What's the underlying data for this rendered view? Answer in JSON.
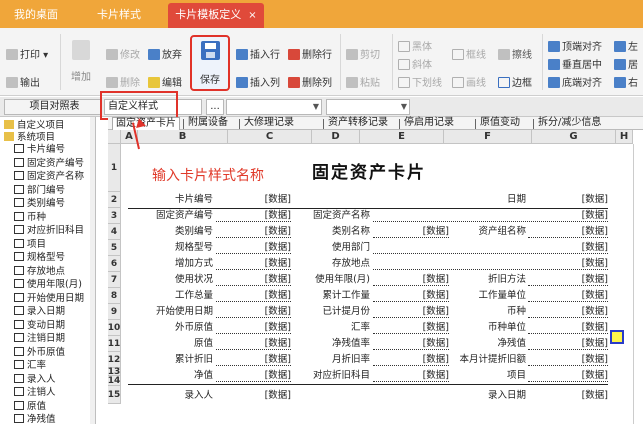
{
  "tabs": [
    {
      "label": "我的桌面"
    },
    {
      "label": "卡片样式"
    },
    {
      "label": "卡片模板定义",
      "close": "×"
    }
  ],
  "toolbar": {
    "print": "打印",
    "export": "输出",
    "add": "增加",
    "modify": "修改",
    "delete": "删除",
    "discard": "放弃",
    "edit": "编辑",
    "save": "保存",
    "insert_row": "插入行",
    "insert_col": "插入列",
    "delete_row": "删除行",
    "delete_col": "删除列",
    "cut": "剪切",
    "paste": "粘贴",
    "bold": "黑体",
    "italic": "斜体",
    "underline": "下划线",
    "frame_line": "框线",
    "draw_line": "画线",
    "border_line": "擦线",
    "border": "边框",
    "align_top": "顶端对齐",
    "align_middle": "垂直居中",
    "align_bottom": "底端对齐",
    "align_left": "左",
    "align_center": "居",
    "align_right": "右"
  },
  "selectors": {
    "project": "项目对照表",
    "style_name": "自定义样式",
    "more": "..."
  },
  "tree": {
    "root": "自定义项目",
    "system": "系统项目",
    "items": [
      "卡片编号",
      "固定资产编号",
      "固定资产名称",
      "部门编号",
      "类别编号",
      "币种",
      "对应折旧科目",
      "项目",
      "规格型号",
      "存放地点",
      "使用年限(月)",
      "开始使用日期",
      "录入日期",
      "变动日期",
      "注销日期",
      "外币原值",
      "汇率",
      "录入人",
      "注销人",
      "原值",
      "净残值"
    ]
  },
  "card_tabs": [
    "固定资产卡片",
    "附属设备",
    "大修理记录",
    "资产转移记录",
    "停启用记录",
    "原值变动",
    "拆分/减少信息"
  ],
  "columns": [
    "A",
    "B",
    "C",
    "D",
    "E",
    "F",
    "G",
    "H"
  ],
  "rows": [
    "1",
    "2",
    "3",
    "4",
    "5",
    "6",
    "7",
    "8",
    "9",
    "10",
    "11",
    "12",
    "13",
    "14",
    "15"
  ],
  "hint": "输入卡片样式名称",
  "card_title": "固定资产卡片",
  "placeholder": "[数据]",
  "form": {
    "card_no": "卡片编号",
    "date": "日期",
    "asset_no": "固定资产编号",
    "asset_name": "固定资产名称",
    "category_no": "类别编号",
    "category_name": "类别名称",
    "asset_group": "资产组名称",
    "spec": "规格型号",
    "dept": "使用部门",
    "add_method": "增加方式",
    "location": "存放地点",
    "status": "使用状况",
    "life": "使用年限(月)",
    "dep_method": "折旧方法",
    "workload": "工作总量",
    "acc_workload": "累计工作量",
    "work_unit": "工作量单位",
    "start_date": "开始使用日期",
    "used_months": "已计提月份",
    "currency": "币种",
    "fc_value": "外币原值",
    "rate": "汇率",
    "currency_unit": "币种单位",
    "orig_value": "原值",
    "residual_rate": "净残值率",
    "residual": "净残值",
    "acc_dep": "累计折旧",
    "monthly_rate": "月折旧率",
    "monthly_dep": "本月计提折旧额",
    "net_value": "净值",
    "dep_account": "对应折旧科目",
    "project": "项目",
    "entered_by": "录入人",
    "entry_date": "录入日期"
  },
  "colors": {
    "tabbar": "#f0a63a",
    "active_tab": "#e04a3a",
    "highlight": "#e0322a",
    "hint": "#e03a2a",
    "selected_cell": "#fff64a"
  }
}
